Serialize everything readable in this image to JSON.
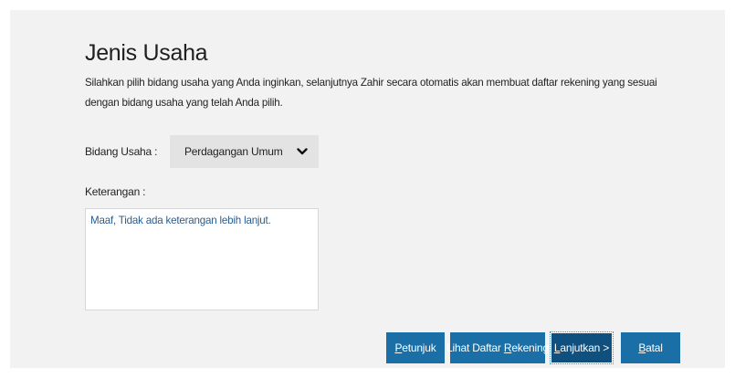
{
  "page": {
    "title": "Jenis Usaha",
    "description": "Silahkan pilih bidang usaha yang Anda inginkan, selanjutnya Zahir secara otomatis akan membuat daftar rekening yang sesuai dengan bidang usaha yang telah Anda pilih."
  },
  "form": {
    "bidang_label": "Bidang Usaha :",
    "bidang_value": "Perdagangan Umum",
    "keterangan_label": "Keterangan :",
    "keterangan_text": "Maaf, Tidak ada keterangan lebih lanjut."
  },
  "buttons": {
    "petunjuk": {
      "mnemonic": "P",
      "rest": "etunjuk"
    },
    "lihat": {
      "pre": "Lihat Daftar ",
      "mnemonic": "R",
      "rest": "ekening"
    },
    "lanjutkan": {
      "mnemonic": "L",
      "rest": "anjutkan >"
    },
    "batal": {
      "mnemonic": "B",
      "rest": "atal"
    }
  },
  "colors": {
    "panel_bg": "#f2f2f2",
    "button_bg": "#1b6fa7",
    "button_active_bg": "#10507e",
    "note_text": "#2a5d8f"
  },
  "icons": {
    "dropdown": "chevron-down-icon"
  }
}
